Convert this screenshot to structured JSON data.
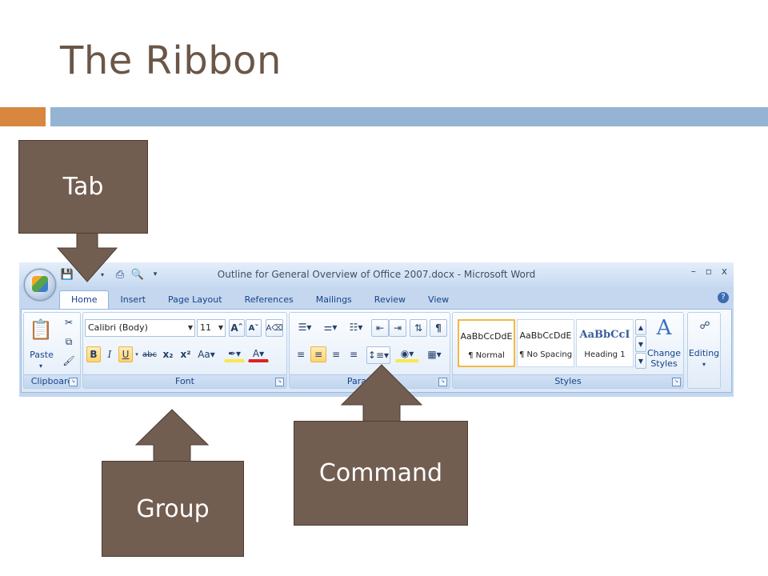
{
  "slide": {
    "title": "The Ribbon"
  },
  "window": {
    "title": "Outline for General Overview of Office 2007.docx - Microsoft Word",
    "controls": [
      "–",
      "▫",
      "x"
    ]
  },
  "tabs": [
    "Home",
    "Insert",
    "Page Layout",
    "References",
    "Mailings",
    "Review",
    "View"
  ],
  "groups": {
    "clipboard": {
      "label": "Clipboard",
      "paste_label": "Paste"
    },
    "font": {
      "label": "Font",
      "font_name": "Calibri (Body)",
      "font_size": "11",
      "change_case": "Aa"
    },
    "paragraph": {
      "label": "Paragraph"
    },
    "styles": {
      "label": "Styles",
      "tiles": [
        {
          "sample": "AaBbCcDdE",
          "name": "¶ Normal"
        },
        {
          "sample": "AaBbCcDdE",
          "name": "¶ No Spacing"
        },
        {
          "sample": "AaBbCcI",
          "name": "Heading 1"
        }
      ],
      "change_styles": "Change Styles"
    },
    "editing": {
      "label": "Editing"
    }
  },
  "callouts": {
    "tab": "Tab",
    "group": "Group",
    "command": "Command"
  },
  "colors": {
    "callout": "#725d51",
    "title": "#6b5647",
    "accent_orange": "#d9863f",
    "accent_blue": "#95b3d2"
  }
}
